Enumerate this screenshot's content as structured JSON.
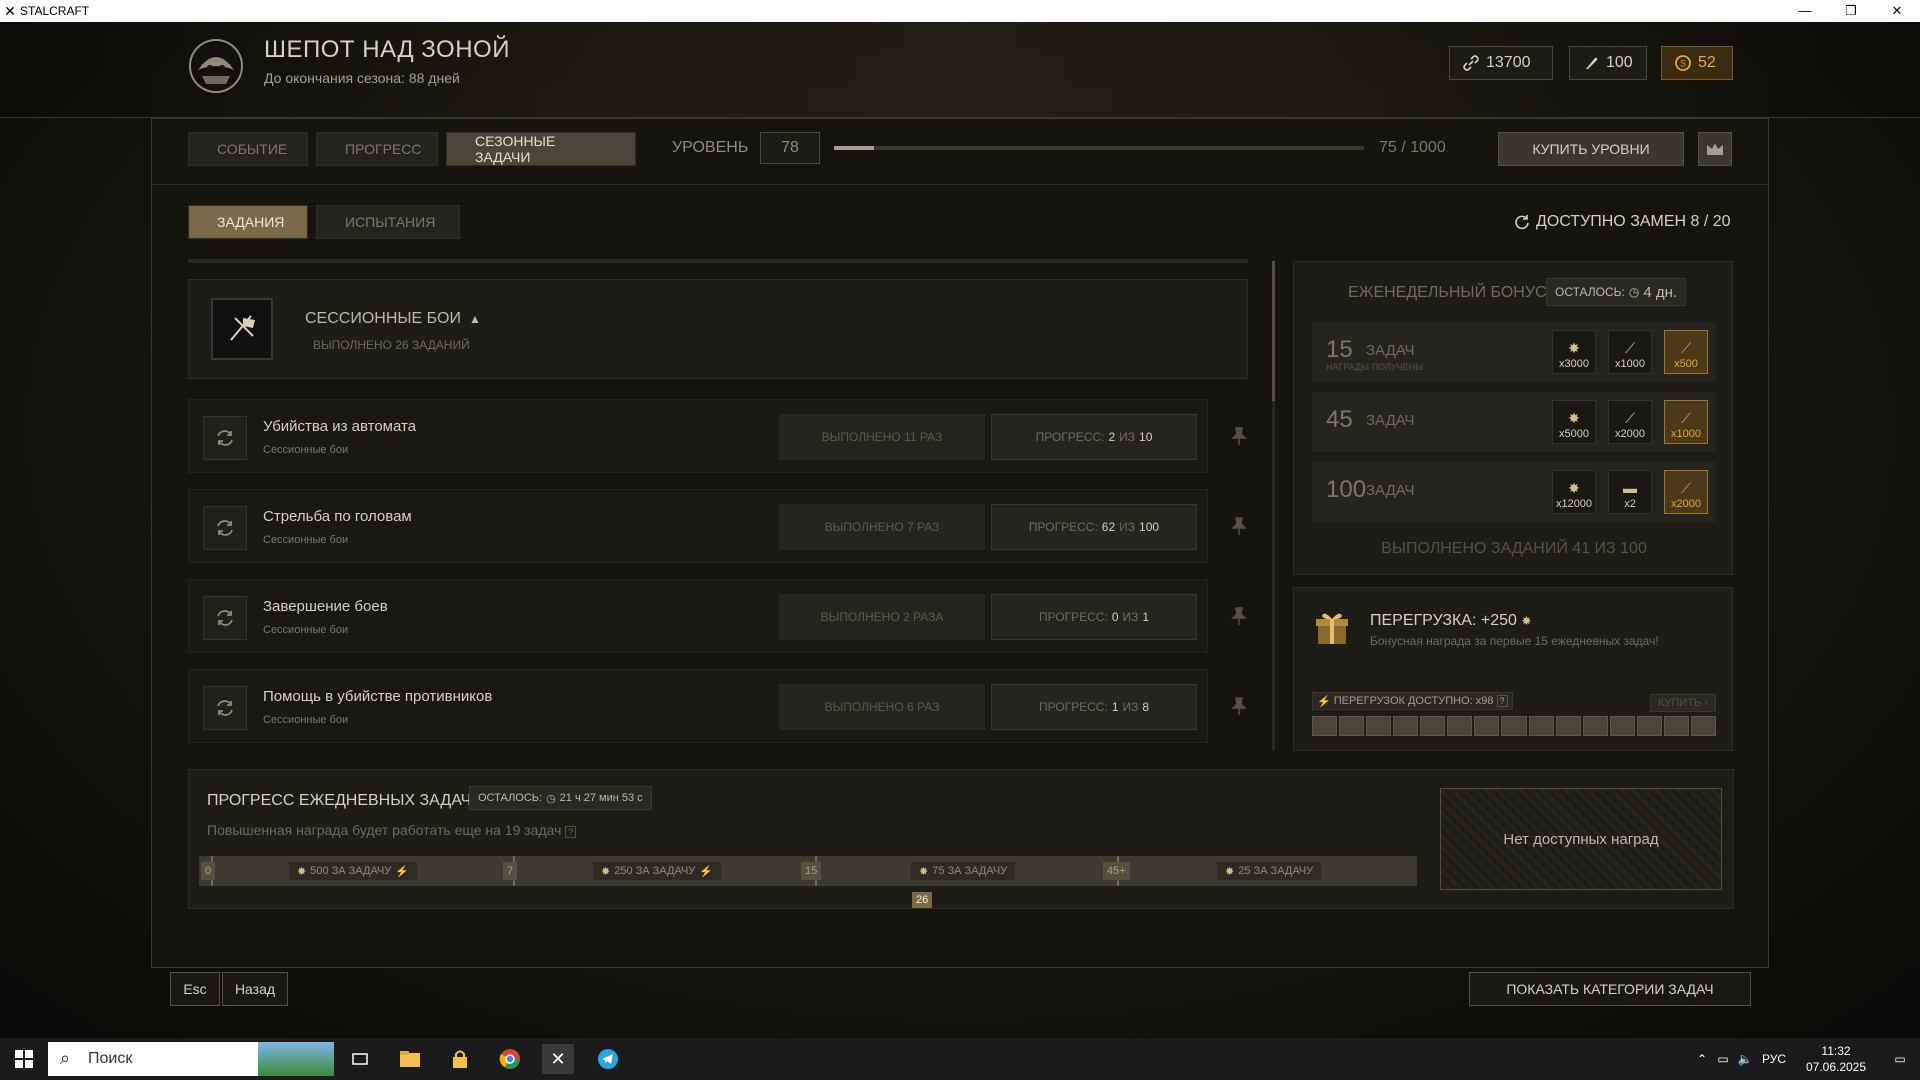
{
  "window": {
    "title": "STALCRAFT"
  },
  "header": {
    "season_title": "ШЕПОТ НАД ЗОНОЙ",
    "season_sub": "До окончания сезона: 88 дней",
    "currency": [
      {
        "value": "13700",
        "kind": "link"
      },
      {
        "value": "100",
        "kind": "feather"
      },
      {
        "value": "52",
        "kind": "gold"
      }
    ]
  },
  "nav": {
    "tabs": [
      "СОБЫТИЕ",
      "ПРОГРЕСС",
      "СЕЗОННЫЕ ЗАДАЧИ"
    ],
    "active": 2,
    "level_label": "УРОВЕНЬ",
    "level_value": "78",
    "progress_text": "75 / 1000",
    "progress_fraction": 0.075,
    "buy_levels": "КУПИТЬ УРОВНИ"
  },
  "subtabs": {
    "items": [
      "ЗАДАНИЯ",
      "ИСПЫТАНИЯ"
    ],
    "active": 0
  },
  "replacements": "ДОСТУПНО ЗАМЕН 8 / 20",
  "category": {
    "title": "СЕССИОННЫЕ БОИ",
    "sub": "ВЫПОЛНЕНО 26 ЗАДАНИЙ"
  },
  "tasks": [
    {
      "name": "Убийства из автомата",
      "category": "Сессионные бои",
      "done": "ВЫПОЛНЕНО 11 РАЗ",
      "progress_label": "ПРОГРЕСС:",
      "current": "2",
      "sep": "ИЗ",
      "total": "10"
    },
    {
      "name": "Стрельба по головам",
      "category": "Сессионные бои",
      "done": "ВЫПОЛНЕНО 7 РАЗ",
      "progress_label": "ПРОГРЕСС:",
      "current": "62",
      "sep": "ИЗ",
      "total": "100"
    },
    {
      "name": "Завершение боев",
      "category": "Сессионные бои",
      "done": "ВЫПОЛНЕНО 2 РАЗА",
      "progress_label": "ПРОГРЕСС:",
      "current": "0",
      "sep": "ИЗ",
      "total": "1"
    },
    {
      "name": "Помощь в убийстве противников",
      "category": "Сессионные бои",
      "done": "ВЫПОЛНЕНО 6 РАЗ",
      "progress_label": "ПРОГРЕСС:",
      "current": "1",
      "sep": "ИЗ",
      "total": "8"
    }
  ],
  "weekly": {
    "title": "ЕЖЕНЕДЕЛЬНЫЙ БОНУС",
    "remaining_label": "ОСТАЛОСЬ:",
    "remaining_value": "4 дн.",
    "rows": [
      {
        "num": "15",
        "label": "ЗАДАЧ",
        "sub": "НАГРАДЫ ПОЛУЧЕНЫ",
        "rewards": [
          "x3000",
          "x1000",
          "x500"
        ]
      },
      {
        "num": "45",
        "label": "ЗАДАЧ",
        "sub": "",
        "rewards": [
          "x5000",
          "x2000",
          "x1000"
        ]
      },
      {
        "num": "100",
        "label": "ЗАДАЧ",
        "sub": "",
        "rewards": [
          "x12000",
          "x2",
          "x2000"
        ]
      }
    ],
    "done": "ВЫПОЛНЕНО ЗАДАНИЙ   41 ИЗ 100"
  },
  "overload": {
    "title": "ПЕРЕГРУЗКА: +250",
    "sub": "Бонусная награда за первые 15 ежедневных задач!",
    "available": "ПЕРЕГРУЗОК ДОСТУПНО: x98",
    "buy": "КУПИТЬ",
    "segments": 15
  },
  "daily": {
    "title": "ПРОГРЕСС ЕЖЕДНЕВНЫХ ЗАДАЧ",
    "remaining_label": "ОСТАЛОСЬ:",
    "remaining_value": "21 ч 27 мин 53 с",
    "sub": "Повышенная награда будет работать еще на 19 задач",
    "marks": [
      "0",
      "7",
      "15",
      "45+"
    ],
    "rewards": [
      "500 ЗА ЗАДАЧУ",
      "250 ЗА ЗАДАЧУ",
      "75 ЗА ЗАДАЧУ",
      "25 ЗА ЗАДАЧУ"
    ],
    "current": "26",
    "no_rewards": "Нет доступных наград"
  },
  "footer": {
    "esc": "Esc",
    "back": "Назад",
    "show_categories": "ПОКАЗАТЬ КАТЕГОРИИ ЗАДАЧ"
  },
  "taskbar": {
    "search": "Поиск",
    "lang": "РУС",
    "time": "11:32",
    "date": "07.06.2025"
  }
}
